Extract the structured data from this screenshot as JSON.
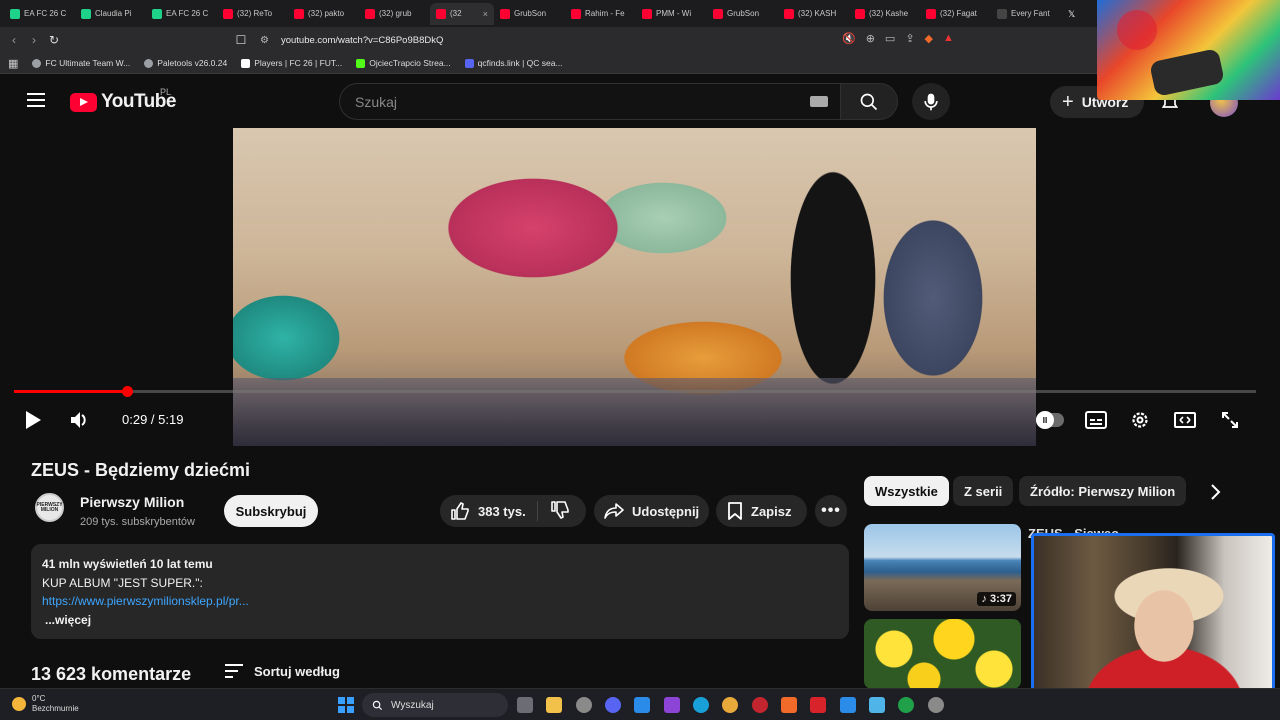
{
  "browser": {
    "tabs": [
      {
        "label": "EA FC 26 C",
        "icon": "fc-icon",
        "color": "#1fd28a"
      },
      {
        "label": "Claudia Pi",
        "icon": "fc-icon",
        "color": "#1fd28a"
      },
      {
        "label": "EA FC 26 C",
        "icon": "fc-icon",
        "color": "#1fd28a"
      },
      {
        "label": "(32) ReTo",
        "icon": "youtube-icon",
        "color": "#ff0033"
      },
      {
        "label": "(32) pakto",
        "icon": "youtube-icon",
        "color": "#ff0033"
      },
      {
        "label": "(32) grub",
        "icon": "youtube-icon",
        "color": "#ff0033"
      },
      {
        "label": "(32",
        "icon": "youtube-icon",
        "color": "#ff0033",
        "active": true
      },
      {
        "label": "GrubSon",
        "icon": "youtube-icon",
        "color": "#ff0033"
      },
      {
        "label": "Rahim - Fe",
        "icon": "youtube-icon",
        "color": "#ff0033"
      },
      {
        "label": "PMM - Wi",
        "icon": "youtube-icon",
        "color": "#ff0033"
      },
      {
        "label": "GrubSon",
        "icon": "youtube-icon",
        "color": "#ff0033"
      },
      {
        "label": "(32) KASH",
        "icon": "youtube-icon",
        "color": "#ff0033"
      },
      {
        "label": "(32) Kashe",
        "icon": "youtube-icon",
        "color": "#ff0033"
      },
      {
        "label": "(32) Fagat",
        "icon": "youtube-icon",
        "color": "#ff0033"
      },
      {
        "label": "Every Fant",
        "icon": "dark-icon",
        "color": "#444444"
      },
      {
        "label": "",
        "icon": "x-icon",
        "color": "#000000"
      }
    ],
    "url": "youtube.com/watch?v=C86Po9B8DkQ",
    "bookmarks": [
      {
        "label": "FC Ultimate Team W...",
        "icon": "globe-icon"
      },
      {
        "label": "Paletools v26.0.24",
        "icon": "globe-icon"
      },
      {
        "label": "Players | FC 26 | FUT...",
        "icon": "futbin-icon"
      },
      {
        "label": "OjciecTrapcio Strea...",
        "icon": "kick-icon"
      },
      {
        "label": "qcfinds.link | QC sea...",
        "icon": "qc-icon"
      }
    ]
  },
  "youtube": {
    "logo_text": "YouTube",
    "country": "PL",
    "search_placeholder": "Szukaj",
    "create_label": "Utwórz",
    "player": {
      "current_time": "0:29",
      "duration": "5:19",
      "time_display": "0:29 / 5:19",
      "progress_fraction": 0.0909,
      "progress_color": "#ff0000"
    },
    "video": {
      "title": "ZEUS - Będziemy dziećmi",
      "channel": "Pierwszy Milion",
      "channel_avatar_text": "PIERWSZY MILION",
      "subscribers": "209 tys. subskrybentów",
      "subscribe_label": "Subskrybuj",
      "likes": "383 tys.",
      "share_label": "Udostępnij",
      "save_label": "Zapisz"
    },
    "description": {
      "stats": "41 mln wyświetleń  10 lat temu",
      "line1": "KUP ALBUM \"JEST SUPER.\":",
      "link": "https://www.pierwszymilionsklep.pl/pr...",
      "more": "...więcej"
    },
    "comments": {
      "count": "13 623 komentarze",
      "sort_label": "Sortuj według"
    },
    "chips": [
      "Wszystkie",
      "Z serii",
      "Źródło: Pierwszy Milion"
    ],
    "recommendations": [
      {
        "title": "ZEUS - Sjeweo",
        "duration": "3:37"
      }
    ]
  },
  "taskbar": {
    "temp": "0°C",
    "weather": "Bezchmurnie",
    "search_label": "Wyszukaj"
  }
}
